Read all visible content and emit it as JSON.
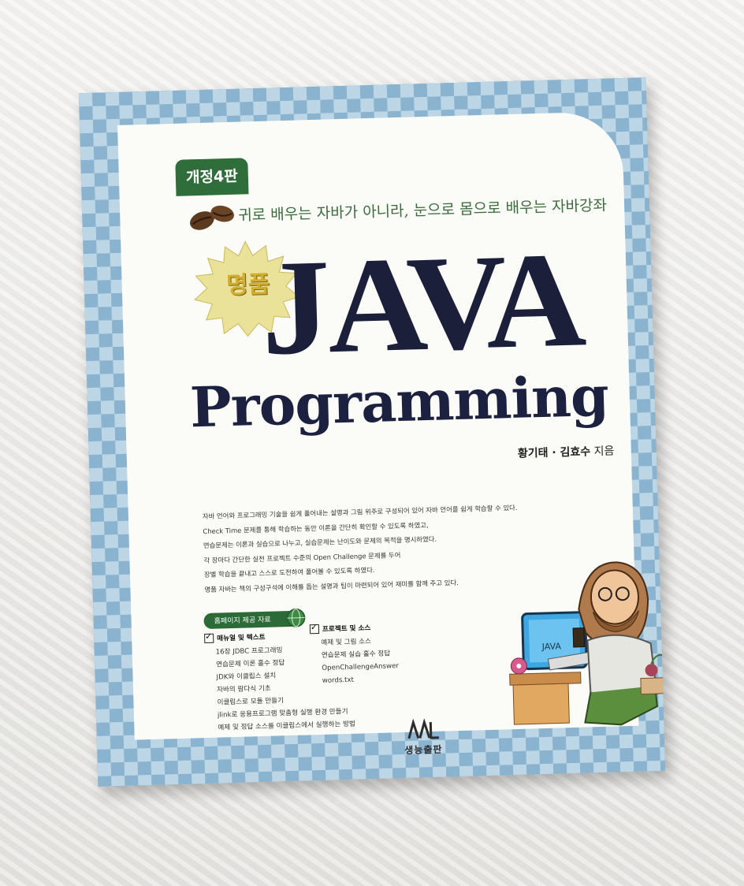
{
  "cover": {
    "edition": "개정4판",
    "tagline": "귀로 배우는 자바가 아니라, 눈으로 몸으로 배우는 자바강좌",
    "badge": "명품",
    "title_main": "JAVA",
    "title_sub": "Programming",
    "authors": "황기태 · 김효수",
    "authors_suffix": "지음",
    "description": [
      "자바 언어와 프로그래밍 기술을 쉽게 풀어내는 설명과 그림 위주로 구성되어 있어 자바 언어를 쉽게 학습할 수 있다.",
      "Check Time 문제를 통해 학습하는 동안 이론을 간단히 확인할 수 있도록 하였고,",
      "연습문제는 이론과 실습으로 나누고, 실습문제는 난이도와 문제의 목적을 명시하였다.",
      "각 장마다 간단한 실전 프로젝트 수준의 Open Challenge 문제를 두어",
      "장별 학습을 끝내고 스스로 도전하여 풀어볼 수 있도록 하였다.",
      "명품 자바는 책의 구성구석에 이해를 돕는 설명과 팁이 마련되어 있어 재미를 함께 주고 있다."
    ],
    "homepage_label": "홈페이지 제공 자료",
    "manual": {
      "heading": "매뉴얼 및 텍스트",
      "items": [
        "16장 JDBC 프로그래밍",
        "연습문제 이론 홀수 정답",
        "JDK와 이클립스 설치",
        "자바의 람다식 기초",
        "이클립스로 모듈 만들기",
        "jlink로 응용프로그램 맞춤형 실행 환경 만들기",
        "예제 및 정답 소스를 이클립스에서 실행하는 방법"
      ]
    },
    "project": {
      "heading": "프로젝트 및 소스",
      "items": [
        "예제 및 그림 소스",
        "연습문제 실습 홀수 정답",
        "OpenChallengeAnswer",
        "words.txt"
      ]
    },
    "publisher": "생능출판",
    "monitor_text": "JAVA"
  }
}
